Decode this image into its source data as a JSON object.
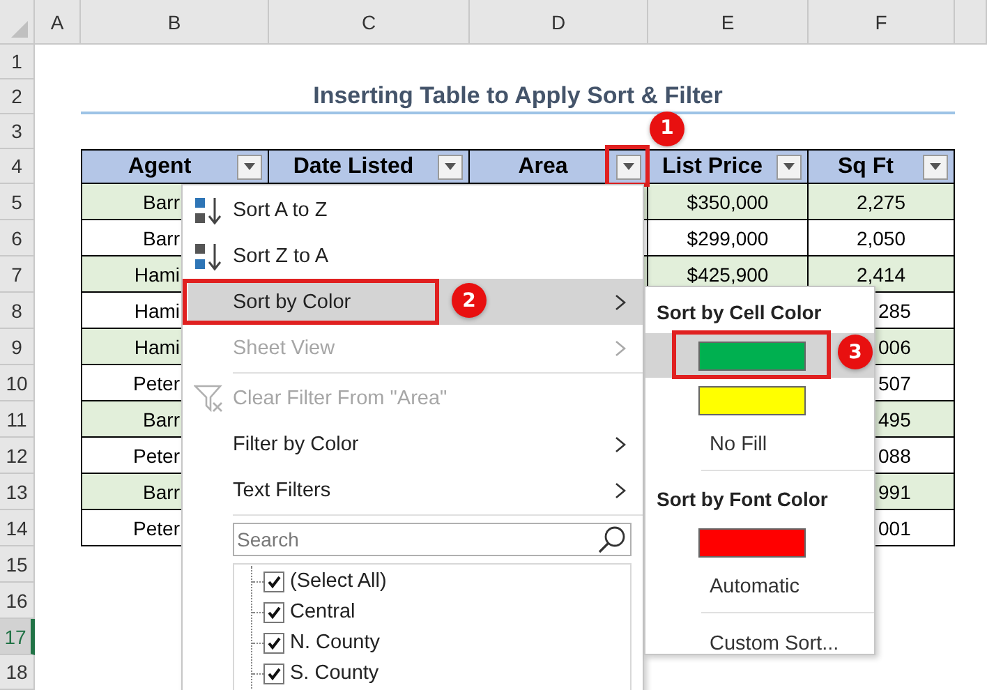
{
  "columns": [
    "A",
    "B",
    "C",
    "D",
    "E",
    "F"
  ],
  "row_headers": [
    {
      "label": "1",
      "selected": false
    },
    {
      "label": "2",
      "selected": false
    },
    {
      "label": "3",
      "selected": false
    },
    {
      "label": "4",
      "selected": false
    },
    {
      "label": "5",
      "selected": false
    },
    {
      "label": "6",
      "selected": false
    },
    {
      "label": "7",
      "selected": false
    },
    {
      "label": "8",
      "selected": false
    },
    {
      "label": "9",
      "selected": false
    },
    {
      "label": "10",
      "selected": false
    },
    {
      "label": "11",
      "selected": false
    },
    {
      "label": "12",
      "selected": false
    },
    {
      "label": "13",
      "selected": false
    },
    {
      "label": "14",
      "selected": false
    },
    {
      "label": "15",
      "selected": false
    },
    {
      "label": "16",
      "selected": false
    },
    {
      "label": "17",
      "selected": true
    },
    {
      "label": "18",
      "selected": false
    }
  ],
  "title": "Inserting Table to Apply Sort & Filter",
  "table": {
    "headers": [
      {
        "label": "Agent"
      },
      {
        "label": "Date Listed"
      },
      {
        "label": "Area",
        "callout": "1"
      },
      {
        "label": "List Price"
      },
      {
        "label": "Sq Ft"
      }
    ],
    "rows": [
      {
        "agent": "Barr",
        "list_price": "$350,000",
        "sq_ft": "2,275"
      },
      {
        "agent": "Barr",
        "list_price": "$299,000",
        "sq_ft": "2,050"
      },
      {
        "agent": "Hami",
        "list_price": "$425,900",
        "sq_ft": "2,414"
      },
      {
        "agent": "Hami",
        "sq_ft": "285"
      },
      {
        "agent": "Hami",
        "sq_ft": "006"
      },
      {
        "agent": "Peter",
        "sq_ft": "507"
      },
      {
        "agent": "Barr",
        "sq_ft": "495"
      },
      {
        "agent": "Peter",
        "sq_ft": "088"
      },
      {
        "agent": "Barr",
        "sq_ft": "991"
      },
      {
        "agent": "Peter",
        "sq_ft": "001"
      }
    ]
  },
  "filter_menu": {
    "items": [
      {
        "kind": "sort_ascending",
        "label": "Sort A to Z",
        "disabled": false,
        "selected": false
      },
      {
        "kind": "sort_descending",
        "label": "Sort Z to A",
        "disabled": false,
        "selected": false
      },
      {
        "kind": "submenu",
        "label": "Sort by Color",
        "disabled": false,
        "selected": true,
        "callout": "2"
      },
      {
        "kind": "submenu",
        "label": "Sheet View",
        "disabled": true,
        "selected": false
      },
      {
        "kind": "separator"
      },
      {
        "kind": "clear_filter",
        "label": "Clear Filter From \"Area\"",
        "disabled": true,
        "selected": false
      },
      {
        "kind": "submenu",
        "label": "Filter by Color",
        "disabled": false,
        "selected": false
      },
      {
        "kind": "submenu",
        "label": "Text Filters",
        "disabled": false,
        "selected": false
      },
      {
        "kind": "separator"
      }
    ],
    "search": {
      "placeholder": "Search"
    },
    "values": [
      {
        "label": "(Select All)",
        "checked": true
      },
      {
        "label": "Central",
        "checked": true
      },
      {
        "label": "N. County",
        "checked": true
      },
      {
        "label": "S. County",
        "checked": true
      }
    ]
  },
  "color_submenu": {
    "sections": [
      {
        "heading": "Sort by Cell Color",
        "options": [
          {
            "kind": "swatch",
            "color": "#00b050",
            "selected": true,
            "callout": "3"
          },
          {
            "kind": "swatch",
            "color": "#ffff00",
            "selected": false
          },
          {
            "kind": "text",
            "label": "No Fill",
            "selected": false
          }
        ]
      },
      {
        "heading": "Sort by Font Color",
        "options": [
          {
            "kind": "swatch",
            "color": "#ff0000",
            "selected": false
          },
          {
            "kind": "text",
            "label": "Automatic",
            "selected": false
          }
        ]
      }
    ],
    "footer": "Custom Sort..."
  }
}
